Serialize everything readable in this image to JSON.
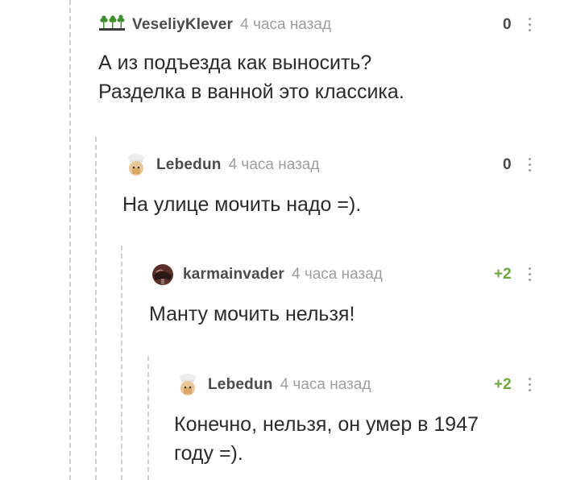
{
  "comments": [
    {
      "author": "VeseliyKlever",
      "time": "4 часа назад",
      "rating": "0",
      "text": "А из подъезда как выносить?\nРазделка в ванной это классика.",
      "avatar": "clover-avatar"
    },
    {
      "author": "Lebedun",
      "time": "4 часа назад",
      "rating": "0",
      "text": "На улице мочить надо =).",
      "avatar": "chef-avatar"
    },
    {
      "author": "karmainvader",
      "time": "4 часа назад",
      "rating": "+2",
      "text": "Манту мочить нельзя!",
      "avatar": "helmet-avatar"
    },
    {
      "author": "Lebedun",
      "time": "4 часа назад",
      "rating": "+2",
      "text": "Конечно, нельзя, он умер в 1947\nгоду =).",
      "avatar": "chef-avatar"
    }
  ],
  "colors": {
    "author": "#4a4a4a",
    "time": "#9e9e9e",
    "rating_positive": "#6ea73f",
    "thread_line": "#cfcfcf"
  }
}
